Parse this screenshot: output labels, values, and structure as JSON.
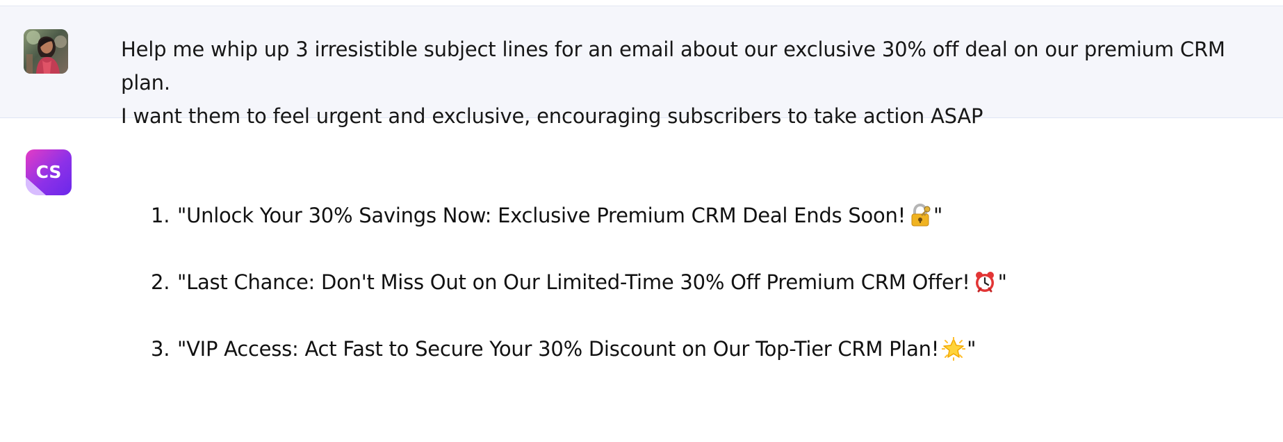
{
  "chat": {
    "user_message": {
      "avatar": "user-avatar-photo",
      "text": "Help me whip up 3 irresistible subject lines for an email about our exclusive 30% off deal on our premium CRM plan.\nI want them to feel urgent and exclusive, encouraging subscribers to take action ASAP"
    },
    "assistant_message": {
      "avatar_label": "CS",
      "avatar_icon": "cs-logo-icon",
      "items": [
        {
          "number": "1.",
          "before": "\"Unlock Your 30% Savings Now: Exclusive Premium CRM Deal Ends Soon! ",
          "icon": "locked-with-key-icon",
          "after": "\""
        },
        {
          "number": "2.",
          "before": "\"Last Chance: Don't Miss Out on Our Limited-Time 30% Off Premium CRM Offer! ",
          "icon": "alarm-clock-icon",
          "after": "\""
        },
        {
          "number": "3.",
          "before": "\"VIP Access: Act Fast to Secure Your 30% Discount on Our Top-Tier CRM Plan! ",
          "icon": "glowing-star-icon",
          "after": "\""
        }
      ]
    }
  },
  "colors": {
    "user_block_bg": "#f5f6fb",
    "brand_gradient_start": "#e43cc4",
    "brand_gradient_end": "#6a28ea",
    "text": "#111111"
  }
}
